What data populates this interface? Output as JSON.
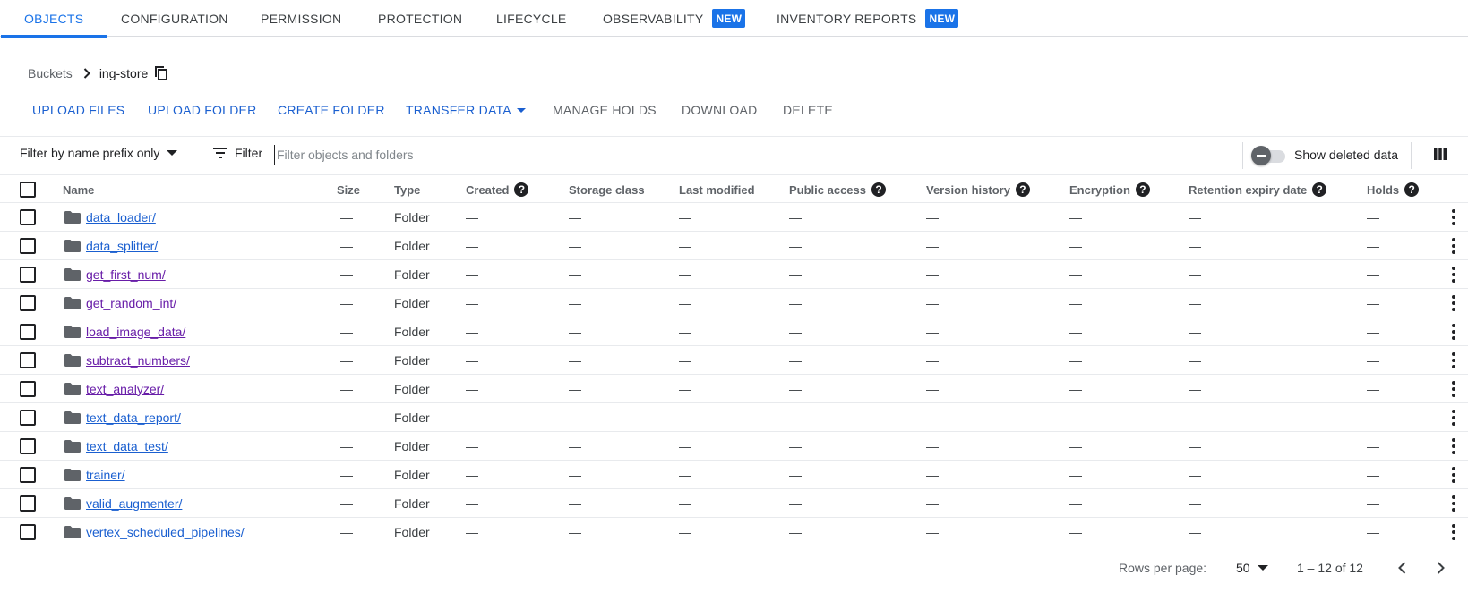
{
  "tabs": [
    {
      "label": "OBJECTS",
      "active": true,
      "badge": ""
    },
    {
      "label": "CONFIGURATION",
      "active": false,
      "badge": ""
    },
    {
      "label": "PERMISSION",
      "active": false,
      "badge": ""
    },
    {
      "label": "PROTECTION",
      "active": false,
      "badge": ""
    },
    {
      "label": "LIFECYCLE",
      "active": false,
      "badge": ""
    },
    {
      "label": "OBSERVABILITY",
      "active": false,
      "badge": "NEW"
    },
    {
      "label": "INVENTORY REPORTS",
      "active": false,
      "badge": "NEW"
    }
  ],
  "breadcrumb": {
    "root": "Buckets",
    "current": "ing-store"
  },
  "actions": {
    "upload_files": "UPLOAD FILES",
    "upload_folder": "UPLOAD FOLDER",
    "create_folder": "CREATE FOLDER",
    "transfer_data": "TRANSFER DATA",
    "manage_holds": "MANAGE HOLDS",
    "download": "DOWNLOAD",
    "delete": "DELETE"
  },
  "filterbar": {
    "prefix_mode": "Filter by name prefix only",
    "filter_label": "Filter",
    "placeholder": "Filter objects and folders",
    "show_deleted_label": "Show deleted data",
    "show_deleted_on": false
  },
  "columns": {
    "name": "Name",
    "size": "Size",
    "type": "Type",
    "created": "Created",
    "storage_class": "Storage class",
    "last_modified": "Last modified",
    "public_access": "Public access",
    "version_history": "Version history",
    "encryption": "Encryption",
    "retention": "Retention expiry date",
    "holds": "Holds"
  },
  "help_glyph": "?",
  "empty_value": "—",
  "rows": [
    {
      "name": "data_loader/",
      "type": "Folder",
      "visited": false
    },
    {
      "name": "data_splitter/",
      "type": "Folder",
      "visited": false
    },
    {
      "name": "get_first_num/",
      "type": "Folder",
      "visited": true
    },
    {
      "name": "get_random_int/",
      "type": "Folder",
      "visited": true
    },
    {
      "name": "load_image_data/",
      "type": "Folder",
      "visited": true
    },
    {
      "name": "subtract_numbers/",
      "type": "Folder",
      "visited": true
    },
    {
      "name": "text_analyzer/",
      "type": "Folder",
      "visited": true
    },
    {
      "name": "text_data_report/",
      "type": "Folder",
      "visited": false
    },
    {
      "name": "text_data_test/",
      "type": "Folder",
      "visited": false
    },
    {
      "name": "trainer/",
      "type": "Folder",
      "visited": false
    },
    {
      "name": "valid_augmenter/",
      "type": "Folder",
      "visited": false
    },
    {
      "name": "vertex_scheduled_pipelines/",
      "type": "Folder",
      "visited": false
    }
  ],
  "pagination": {
    "rows_per_page_label": "Rows per page:",
    "rows_per_page": "50",
    "range": "1 – 12 of 12"
  },
  "colors": {
    "accent": "#1a73e8",
    "link": "#1a5fd0",
    "visited_link": "#681da8"
  }
}
